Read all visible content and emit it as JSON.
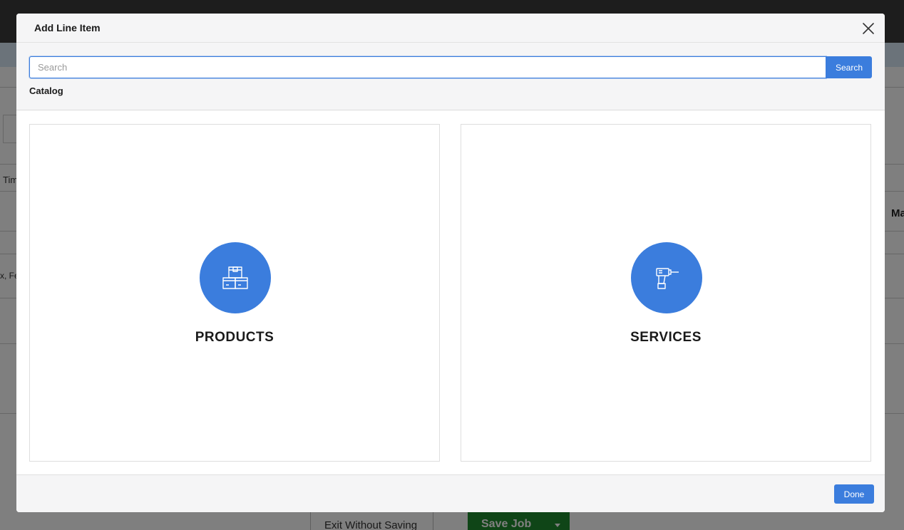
{
  "background": {
    "fragments": [
      {
        "id": "tim",
        "text": "Tim"
      },
      {
        "id": "ma",
        "text": "Ma"
      },
      {
        "id": "x-fe",
        "text": "x, Fe"
      }
    ],
    "exit_label": "Exit Without Saving",
    "save_label": "Save Job"
  },
  "modal": {
    "title": "Add Line Item",
    "search": {
      "placeholder": "Search",
      "value": "",
      "button_label": "Search"
    },
    "catalog_label": "Catalog",
    "cards": [
      {
        "label": "PRODUCTS",
        "icon": "boxes-icon"
      },
      {
        "label": "SERVICES",
        "icon": "drill-icon"
      }
    ],
    "done_label": "Done",
    "accent_color": "#3b7ddd"
  }
}
